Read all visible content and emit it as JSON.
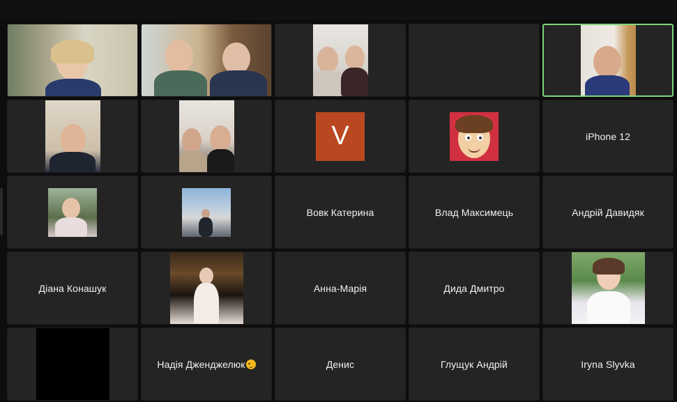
{
  "window": {
    "title": ""
  },
  "participants": [
    {
      "id": "p1",
      "type": "video",
      "name": ""
    },
    {
      "id": "p2",
      "type": "video",
      "name": ""
    },
    {
      "id": "p3",
      "type": "video",
      "name": ""
    },
    {
      "id": "p4",
      "type": "empty",
      "name": ""
    },
    {
      "id": "p5",
      "type": "video",
      "name": "",
      "active_speaker": true
    },
    {
      "id": "p6",
      "type": "video",
      "name": ""
    },
    {
      "id": "p7",
      "type": "video",
      "name": ""
    },
    {
      "id": "p8",
      "type": "avatar-letter",
      "letter": "V",
      "color": "#b9471f"
    },
    {
      "id": "p9",
      "type": "avatar-cartoon",
      "color": "#d13040"
    },
    {
      "id": "p10",
      "type": "name",
      "name": "iPhone 12"
    },
    {
      "id": "p11",
      "type": "photo",
      "name": ""
    },
    {
      "id": "p12",
      "type": "photo",
      "name": ""
    },
    {
      "id": "p13",
      "type": "name",
      "name": "Вовк Катерина"
    },
    {
      "id": "p14",
      "type": "name",
      "name": "Влад Максимець"
    },
    {
      "id": "p15",
      "type": "name",
      "name": "Андрій Давидяк"
    },
    {
      "id": "p16",
      "type": "name",
      "name": "Діана Конашук"
    },
    {
      "id": "p17",
      "type": "photo",
      "name": ""
    },
    {
      "id": "p18",
      "type": "name",
      "name": "Анна-Марія"
    },
    {
      "id": "p19",
      "type": "name",
      "name": "Дида Дмитро"
    },
    {
      "id": "p20",
      "type": "photo",
      "name": ""
    },
    {
      "id": "p21",
      "type": "black-video",
      "name": ""
    },
    {
      "id": "p22",
      "type": "name",
      "name": "Надія Дженджелюк",
      "emoji": "winking-face"
    },
    {
      "id": "p23",
      "type": "name",
      "name": "Денис"
    },
    {
      "id": "p24",
      "type": "name",
      "name": "Глущук Андрій"
    },
    {
      "id": "p25",
      "type": "name",
      "name": "Iryna Slyvka"
    }
  ],
  "colors": {
    "background": "#0d0d0d",
    "tile": "#242424",
    "active_border": "#7cd67c"
  }
}
